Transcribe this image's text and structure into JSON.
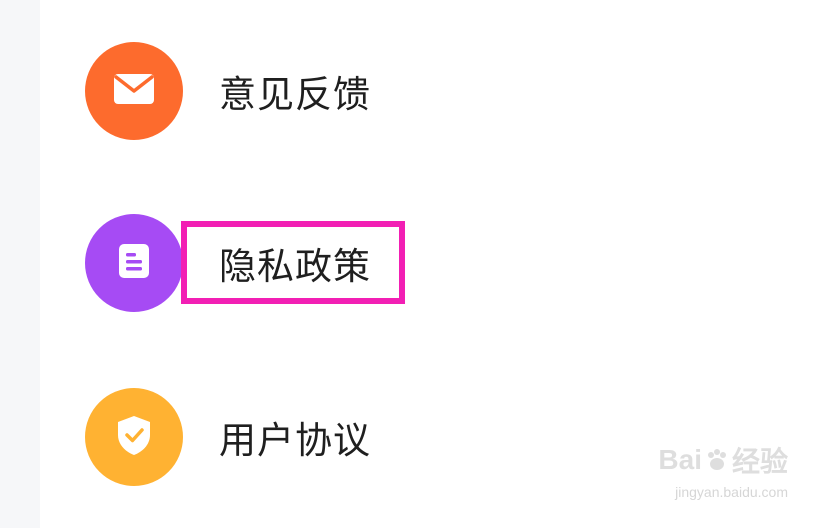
{
  "menu": {
    "items": [
      {
        "label": "意见反馈",
        "icon": "mail-icon",
        "color": "#fd6b2d"
      },
      {
        "label": "隐私政策",
        "icon": "document-icon",
        "color": "#a64bf4"
      },
      {
        "label": "用户协议",
        "icon": "shield-check-icon",
        "color": "#ffb232"
      }
    ]
  },
  "highlight": {
    "color": "#f21fb4"
  },
  "watermark": {
    "brand_left": "Bai",
    "brand_right": "经验",
    "url": "jingyan.baidu.com"
  }
}
